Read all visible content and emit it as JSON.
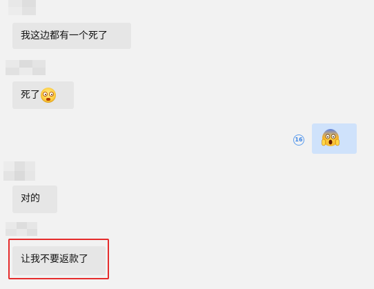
{
  "messages": [
    {
      "text": "我这边都有一个死了",
      "sender": "other"
    },
    {
      "text": "死了",
      "sender": "other",
      "emoji": "dizzy-face-emoji"
    },
    {
      "sender": "self",
      "emoji": "face-screaming-in-fear-emoji",
      "read_count": "16"
    },
    {
      "text": "对的",
      "sender": "other"
    },
    {
      "text": "让我不要返款了",
      "sender": "other",
      "highlighted": true
    }
  ],
  "colors": {
    "background": "#f2f2f2",
    "incoming_bubble": "#e6e6e6",
    "outgoing_bubble": "#cfe2fb",
    "read_badge": "#3d86e6",
    "highlight_box": "#e52b2b"
  }
}
